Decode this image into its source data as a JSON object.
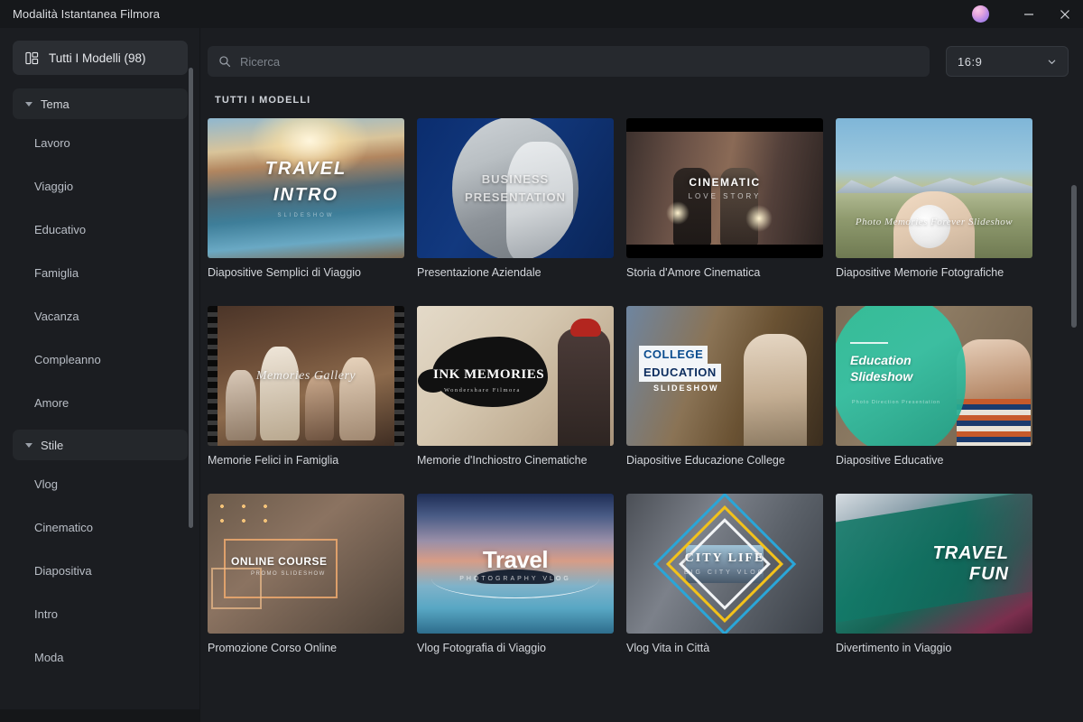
{
  "window": {
    "title": "Modalità Istantanea Filmora",
    "avatar": "user-avatar",
    "minimize_label": "−",
    "close_label": "×"
  },
  "sidebar": {
    "all_templates": {
      "label": "Tutti I Modelli (98)",
      "icon": "layout-grid-icon"
    },
    "groups": [
      {
        "label": "Tema",
        "expanded": true,
        "items": [
          {
            "label": "Lavoro"
          },
          {
            "label": "Viaggio"
          },
          {
            "label": "Educativo"
          },
          {
            "label": "Famiglia"
          },
          {
            "label": "Vacanza"
          },
          {
            "label": "Compleanno"
          },
          {
            "label": "Amore"
          }
        ]
      },
      {
        "label": "Stile",
        "expanded": true,
        "items": [
          {
            "label": "Vlog"
          },
          {
            "label": "Cinematico"
          },
          {
            "label": "Diapositiva"
          },
          {
            "label": "Intro"
          },
          {
            "label": "Moda"
          }
        ]
      }
    ]
  },
  "toolbar": {
    "search": {
      "placeholder": "Ricerca",
      "value": "",
      "icon": "search-icon"
    },
    "aspect_ratio": {
      "value": "16:9",
      "icon": "chevron-down-icon"
    }
  },
  "main": {
    "section_title": "TUTTI I MODELLI",
    "templates": [
      {
        "title": "Diapositive Semplici di Viaggio",
        "overlay_title": "TRAVEL",
        "overlay_title2": "INTRO",
        "overlay_sub": "SLIDESHOW"
      },
      {
        "title": "Presentazione Aziendale",
        "overlay_title": "BUSINESS",
        "overlay_title2": "PRESENTATION"
      },
      {
        "title": "Storia d'Amore Cinematica",
        "overlay_title": "CINEMATIC",
        "overlay_sub": "LOVE STORY"
      },
      {
        "title": "Diapositive Memorie Fotografiche",
        "overlay_title": "Photo Memories Forever Slideshow"
      },
      {
        "title": "Memorie Felici in Famiglia",
        "overlay_title": "Memories Gallery"
      },
      {
        "title": "Memorie d'Inchiostro Cinematiche",
        "overlay_title": "INK MEMORIES",
        "overlay_sub": "Wondershare Filmora"
      },
      {
        "title": "Diapositive Educazione College",
        "overlay_title": "COLLEGE",
        "overlay_title2": "EDUCATION",
        "overlay_sub": "SLIDESHOW"
      },
      {
        "title": "Diapositive Educative",
        "overlay_title": "Education",
        "overlay_title2": "Slideshow",
        "overlay_sub": "Photo Direction Presentation"
      },
      {
        "title": "Promozione Corso Online",
        "overlay_title": "ONLINE COURSE",
        "overlay_sub": "PROMO SLIDESHOW"
      },
      {
        "title": "Vlog Fotografia di Viaggio",
        "overlay_title": "Travel",
        "overlay_sub": "PHOTOGRAPHY VLOG"
      },
      {
        "title": "Vlog Vita in Città",
        "overlay_title": "CITY LIFE",
        "overlay_sub": "BIG CITY VLOG"
      },
      {
        "title": "Divertimento in Viaggio",
        "overlay_title": "TRAVEL",
        "overlay_title2": "FUN"
      }
    ]
  },
  "colors": {
    "window_bg": "#1b1d21",
    "titlebar_bg": "#16181b",
    "panel_active": "#2b2e33",
    "group_header": "#24272b",
    "input_bg": "#26292e",
    "text_primary": "#e6e8ec",
    "text_secondary": "#b9bec6",
    "scrollbar": "#54585e"
  }
}
